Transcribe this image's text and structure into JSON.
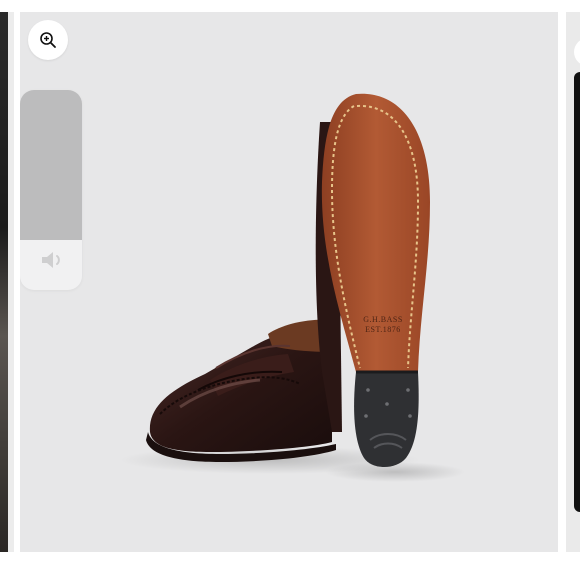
{
  "gallery": {
    "zoom_icon": "zoom-in-icon",
    "volume": {
      "level": 0.75,
      "icon": "speaker-icon"
    },
    "product_image": {
      "sole_stamp_line1": "G.H.BASS",
      "sole_stamp_line2": "EST.1876"
    }
  },
  "colors": {
    "slide_background": "#e7e7e8",
    "leather": "#2b1614",
    "sole": "#a44f2c",
    "heel_rubber": "#2f3033"
  }
}
